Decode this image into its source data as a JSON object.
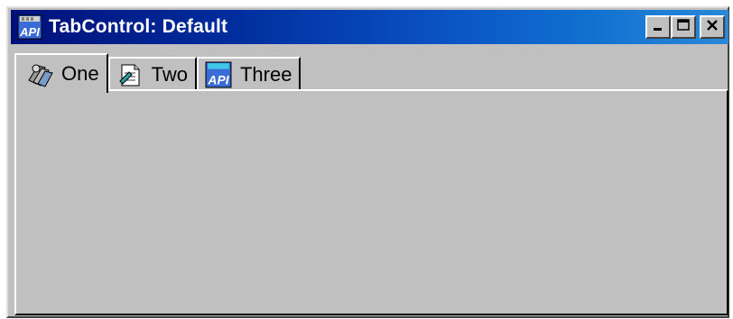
{
  "window": {
    "title": "TabControl: Default",
    "title_icon": "api-app-icon",
    "buttons": {
      "minimize_icon": "minimize-icon",
      "maximize_icon": "maximize-icon",
      "close_icon": "close-icon"
    }
  },
  "tabs": [
    {
      "label": "One",
      "icon": "stack-people-icon",
      "active": true
    },
    {
      "label": "Two",
      "icon": "document-edit-icon",
      "active": false
    },
    {
      "label": "Three",
      "icon": "api-app-icon",
      "active": false
    }
  ],
  "colors": {
    "titlebar_start": "#00107a",
    "titlebar_end": "#2a88d8",
    "face": "#c0c0c0"
  }
}
